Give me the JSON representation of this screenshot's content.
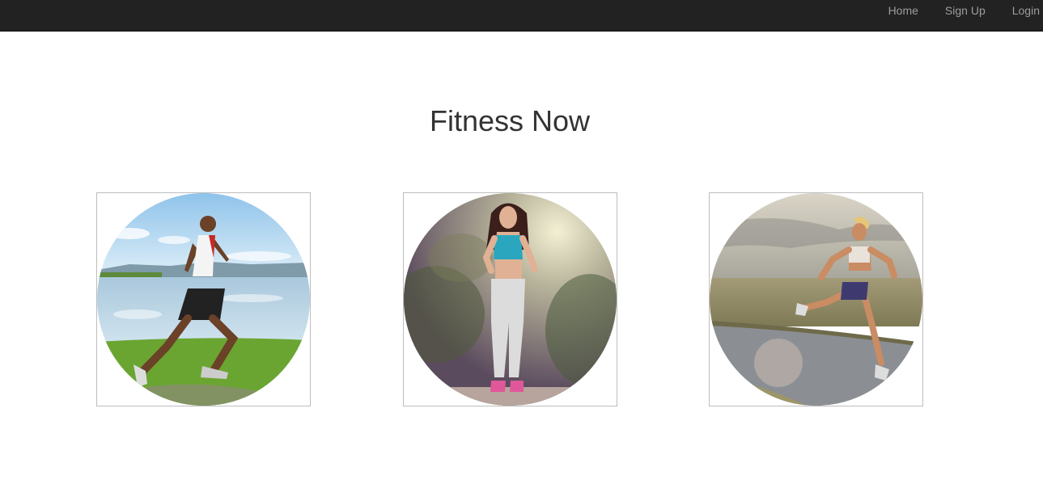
{
  "navbar": {
    "links": [
      {
        "label": "Home"
      },
      {
        "label": "Sign Up"
      },
      {
        "label": "Login"
      }
    ]
  },
  "main": {
    "title": "Fitness Now",
    "images": [
      {
        "icon": "runner-by-lake-photo"
      },
      {
        "icon": "woman-running-in-forest-photo"
      },
      {
        "icon": "woman-sprinting-on-road-photo"
      }
    ]
  },
  "colors": {
    "navbar_bg": "#222222",
    "nav_link": "#9d9d9d",
    "title": "#333333",
    "thumb_border": "#bdbdbd"
  }
}
